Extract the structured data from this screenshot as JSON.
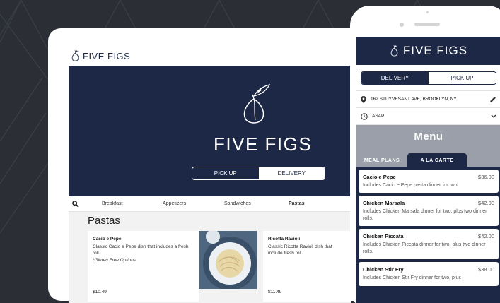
{
  "brand": {
    "name": "FIVE FIGS"
  },
  "laptop": {
    "toggle": {
      "pickup": "PICK UP",
      "delivery": "DELIVERY"
    },
    "tabs": [
      "Breakfast",
      "Appetizers",
      "Sandwiches",
      "Pastas"
    ],
    "section_title": "Pastas",
    "cards": [
      {
        "title": "Cacio e Pepe",
        "desc": "Classic Cacio e Pepe dish that includes a fresh roll.",
        "note": "*Gluten Free Options",
        "price": "$10.49"
      },
      {
        "title": "Ricotta Ravioli",
        "desc": "Classic Ricotta Ravioli dish that include fresh roll.",
        "price": "$11.49"
      }
    ]
  },
  "phone": {
    "toggle": {
      "delivery": "DELIVERY",
      "pickup": "PICK UP"
    },
    "address": "162 STUYVESANT AVE, BROOKLYN, NY",
    "time": "ASAP",
    "menu_title": "Menu",
    "menu_tabs": {
      "meal_plans": "MEAL PLANS",
      "a_la_carte": "A LA CARTE"
    },
    "items": [
      {
        "title": "Cacio e Pepe",
        "price": "$36.00",
        "desc": "Includes Cacio e Pepe pasta dinner for two."
      },
      {
        "title": "Chicken Marsala",
        "price": "$42.00",
        "desc": "Includes Chicken Marsala dinner for two, plus two dinner rolls."
      },
      {
        "title": "Chicken Piccata",
        "price": "$42.00",
        "desc": "Includes Chicken Piccata dinner for two, plus two dinner rolls."
      },
      {
        "title": "Chicken Stir Fry",
        "price": "$38.00",
        "desc": "Includes Chicken Stir Fry dinner for two, plus"
      }
    ]
  },
  "colors": {
    "navy": "#1c2845",
    "background": "#2b2e35",
    "menu_gray": "#9a9fa9"
  },
  "icons": [
    "fig-logo-icon",
    "search-icon",
    "location-pin-icon",
    "edit-pencil-icon",
    "clock-icon",
    "chevron-down-icon"
  ]
}
